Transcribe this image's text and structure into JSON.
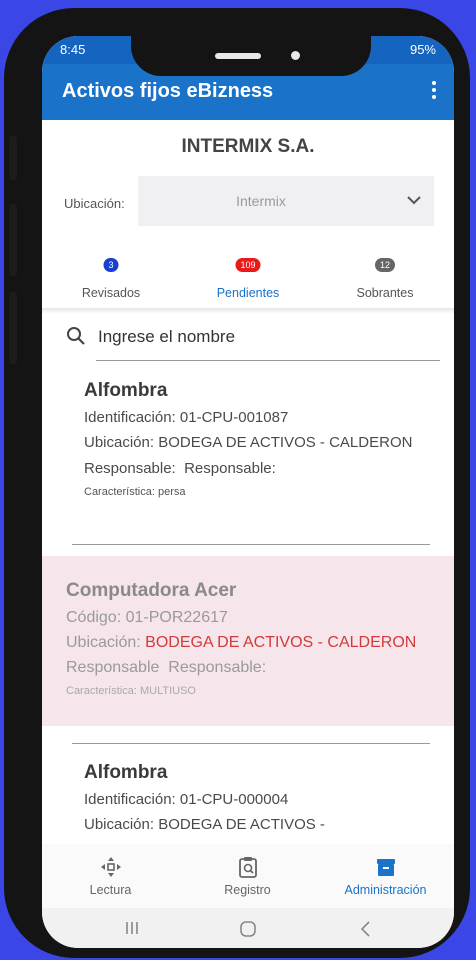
{
  "status": {
    "time": "8:45",
    "right": "95%"
  },
  "appbar": {
    "title": "Activos fijos eBizness"
  },
  "company": "INTERMIX S.A.",
  "location": {
    "label": "Ubicación:",
    "value": "Intermix"
  },
  "tabs": [
    {
      "label": "Revisados",
      "count": "3",
      "badge_color": "#1a3fcf"
    },
    {
      "label": "Pendientes",
      "count": "109",
      "badge_color": "#e81a1a"
    },
    {
      "label": "Sobrantes",
      "count": "12",
      "badge_color": "#666666"
    }
  ],
  "search": {
    "placeholder": "Ingrese el nombre"
  },
  "items": [
    {
      "title": "Alfombra",
      "id_line": "Identificación: 01-CPU-001087",
      "loc_label": "Ubicación:",
      "loc_value": "BODEGA DE ACTIVOS - CALDERON",
      "resp_label": "Responsable:",
      "resp_value": "Responsable:",
      "char_line": "Característica: persa"
    },
    {
      "title": "Computadora Acer",
      "id_line": "Código: 01-POR22617",
      "loc_label": "Ubicación:",
      "loc_value": "BODEGA DE ACTIVOS - CALDERON",
      "resp_label": "Responsable",
      "resp_value": "Responsable:",
      "char_line": "Característica: MULTIUSO"
    },
    {
      "title": "Alfombra",
      "id_line": "Identificación: 01-CPU-000004",
      "loc_line": "Ubicación: BODEGA DE ACTIVOS -"
    }
  ],
  "bottom_nav": [
    {
      "label": "Lectura",
      "icon": "move-arrows-icon"
    },
    {
      "label": "Registro",
      "icon": "clipboard-search-icon"
    },
    {
      "label": "Administración",
      "icon": "archive-box-icon"
    }
  ],
  "colors": {
    "primary": "#1a73c9",
    "highlight": "#f6e5ea",
    "alert": "#d33a3a",
    "background": "#3b46e6"
  }
}
